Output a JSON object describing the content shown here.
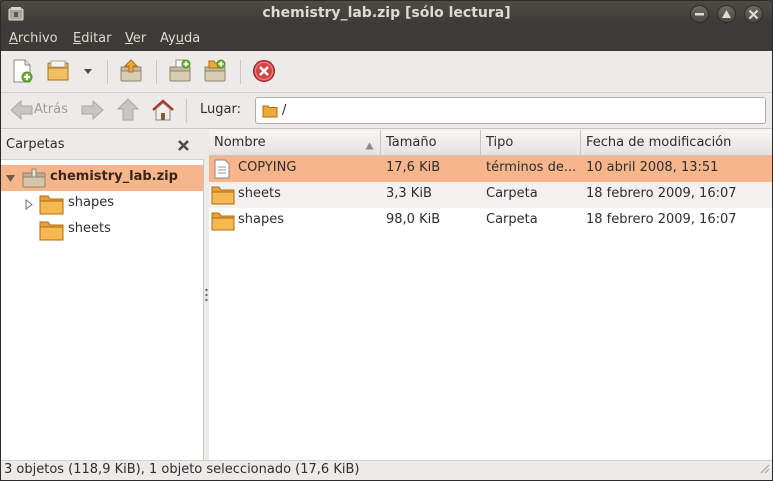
{
  "window": {
    "title": "chemistry_lab.zip [sólo lectura]"
  },
  "menubar": {
    "items": [
      {
        "label": "Archivo",
        "mnemonic": "A",
        "rest": "rchivo"
      },
      {
        "label": "Editar",
        "mnemonic": "E",
        "rest": "ditar"
      },
      {
        "label": "Ver",
        "mnemonic": "V",
        "rest": "er"
      },
      {
        "label": "Ayuda",
        "mnemonic": "u",
        "pre": "Ay",
        "rest": "da"
      }
    ]
  },
  "toolbar": {
    "icons": [
      "new-archive-icon",
      "open-archive-icon",
      "dropdown-arrow-icon",
      "extract-icon",
      "add-files-icon",
      "add-folder-icon",
      "stop-icon"
    ]
  },
  "navbar": {
    "back_label": "Atrás",
    "location_label": "Lugar:",
    "location_value": "/"
  },
  "sidebar": {
    "title": "Carpetas",
    "tree": [
      {
        "label": "chemistry_lab.zip",
        "level": 0,
        "expanded": true,
        "selected": true
      },
      {
        "label": "shapes",
        "level": 1,
        "expandable": true
      },
      {
        "label": "sheets",
        "level": 1,
        "expandable": false
      }
    ]
  },
  "filelist": {
    "columns": [
      "Nombre",
      "Tamaño",
      "Tipo",
      "Fecha de modificación"
    ],
    "rows": [
      {
        "name": "COPYING",
        "size": "17,6 KiB",
        "type": "términos de...",
        "date": "10 abril 2008, 13:51",
        "icon": "text-file-icon",
        "selected": true
      },
      {
        "name": "sheets",
        "size": "3,3 KiB",
        "type": "Carpeta",
        "date": "18 febrero 2009, 16:07",
        "icon": "folder-icon"
      },
      {
        "name": "shapes",
        "size": "98,0 KiB",
        "type": "Carpeta",
        "date": "18 febrero 2009, 16:07",
        "icon": "folder-icon"
      }
    ]
  },
  "statusbar": {
    "text": "3 objetos (118,9 KiB), 1 objeto seleccionado (17,6 KiB)"
  },
  "colors": {
    "selection": "#f6b58a",
    "titlebar": "#3c3b37",
    "folder": "#f0a93a"
  }
}
